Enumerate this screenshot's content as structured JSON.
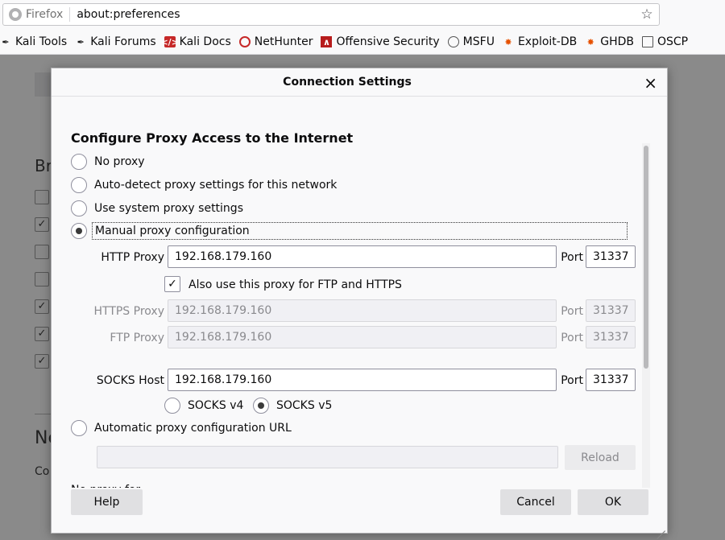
{
  "browser": {
    "identity_label": "Firefox",
    "url": "about:preferences"
  },
  "bookmarks": [
    {
      "label": "Kali Tools",
      "icon": "kali-dragon-icon"
    },
    {
      "label": "Kali Forums",
      "icon": "kali-dragon-icon"
    },
    {
      "label": "Kali Docs",
      "icon": "kali-docs-icon"
    },
    {
      "label": "NetHunter",
      "icon": "nethunter-icon"
    },
    {
      "label": "Offensive Security",
      "icon": "offsec-icon"
    },
    {
      "label": "MSFU",
      "icon": "globe-icon"
    },
    {
      "label": "Exploit-DB",
      "icon": "exploit-db-icon"
    },
    {
      "label": "GHDB",
      "icon": "ghdb-icon"
    },
    {
      "label": "OSCP",
      "icon": "folder-icon"
    }
  ],
  "background": {
    "section_b": "Br",
    "section_n": "Ne",
    "conn_text": "Co"
  },
  "dialog": {
    "title": "Connection Settings",
    "close_glyph": "×",
    "section_title": "Configure Proxy Access to the Internet",
    "options": {
      "no_proxy": "No proxy",
      "auto_detect": "Auto-detect proxy settings for this network",
      "system": "Use system proxy settings",
      "manual": "Manual proxy configuration",
      "auto_url": "Automatic proxy configuration URL"
    },
    "selected_option": "manual",
    "http": {
      "label": "HTTP Proxy",
      "value": "192.168.179.160",
      "port_label": "Port",
      "port": "31337"
    },
    "also_use": {
      "label": "Also use this proxy for FTP and HTTPS",
      "checked": true
    },
    "https": {
      "label": "HTTPS Proxy",
      "value": "192.168.179.160",
      "port_label": "Port",
      "port": "31337"
    },
    "ftp": {
      "label": "FTP Proxy",
      "value": "192.168.179.160",
      "port_label": "Port",
      "port": "31337"
    },
    "socks": {
      "label": "SOCKS Host",
      "value": "192.168.179.160",
      "port_label": "Port",
      "port": "31337"
    },
    "socks_v4": "SOCKS v4",
    "socks_v5": "SOCKS v5",
    "socks_selected": "v5",
    "auto_url_value": "",
    "reload": "Reload",
    "cut_off_text": "No proxy for",
    "help": "Help",
    "cancel": "Cancel",
    "ok": "OK"
  }
}
